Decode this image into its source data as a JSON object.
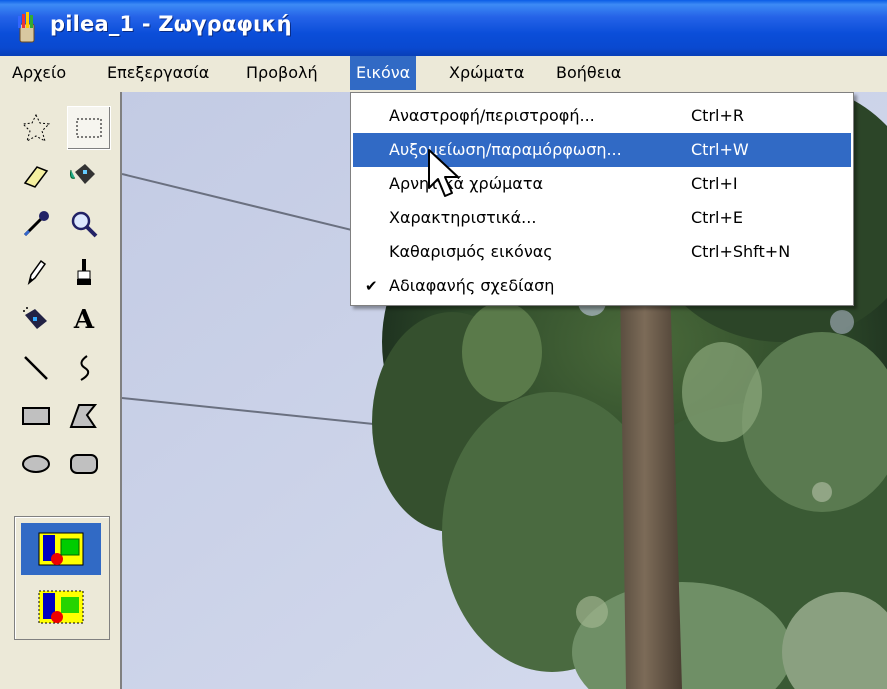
{
  "window": {
    "title": "pilea_1 - Ζωγραφική",
    "icon": "paint-app-icon"
  },
  "menubar": {
    "items": [
      {
        "label": "Αρχείο"
      },
      {
        "label": "Επεξεργασία"
      },
      {
        "label": "Προβολή"
      },
      {
        "label": "Εικόνα",
        "active": true
      },
      {
        "label": "Χρώματα"
      },
      {
        "label": "Βοήθεια"
      }
    ]
  },
  "image_menu": {
    "items": [
      {
        "label": "Αναστροφή/περιστροφή...",
        "shortcut": "Ctrl+R"
      },
      {
        "label": "Αυξομείωση/παραμόρφωση...",
        "shortcut": "Ctrl+W",
        "highlighted": true
      },
      {
        "label": "Αρνητικά χρώματα",
        "shortcut": "Ctrl+I"
      },
      {
        "label": "Χαρακτηριστικά...",
        "shortcut": "Ctrl+E"
      },
      {
        "label": "Καθαρισμός εικόνας",
        "shortcut": "Ctrl+Shft+N"
      },
      {
        "label": "Αδιαφανής σχεδίαση",
        "shortcut": "",
        "checked": true,
        "check_mark": "✔"
      }
    ]
  },
  "toolbox": {
    "tools": [
      "free-form-select-icon",
      "rect-select-icon",
      "eraser-icon",
      "fill-bucket-icon",
      "color-picker-icon",
      "magnifier-icon",
      "pencil-icon",
      "brush-icon",
      "airbrush-icon",
      "text-tool-icon",
      "line-icon",
      "curve-icon",
      "rectangle-icon",
      "polygon-icon",
      "ellipse-icon",
      "rounded-rectangle-icon"
    ],
    "selected_tool": "rect-select-icon",
    "text_tool_glyph": "A",
    "options": [
      "opaque-selection-icon",
      "transparent-selection-icon"
    ],
    "selected_option": "opaque-selection-icon"
  },
  "colors": {
    "title_bar": "#0a49d0",
    "menu_highlight": "#316ac5",
    "chrome": "#ece9d8",
    "sky": "#c6cfe6"
  }
}
